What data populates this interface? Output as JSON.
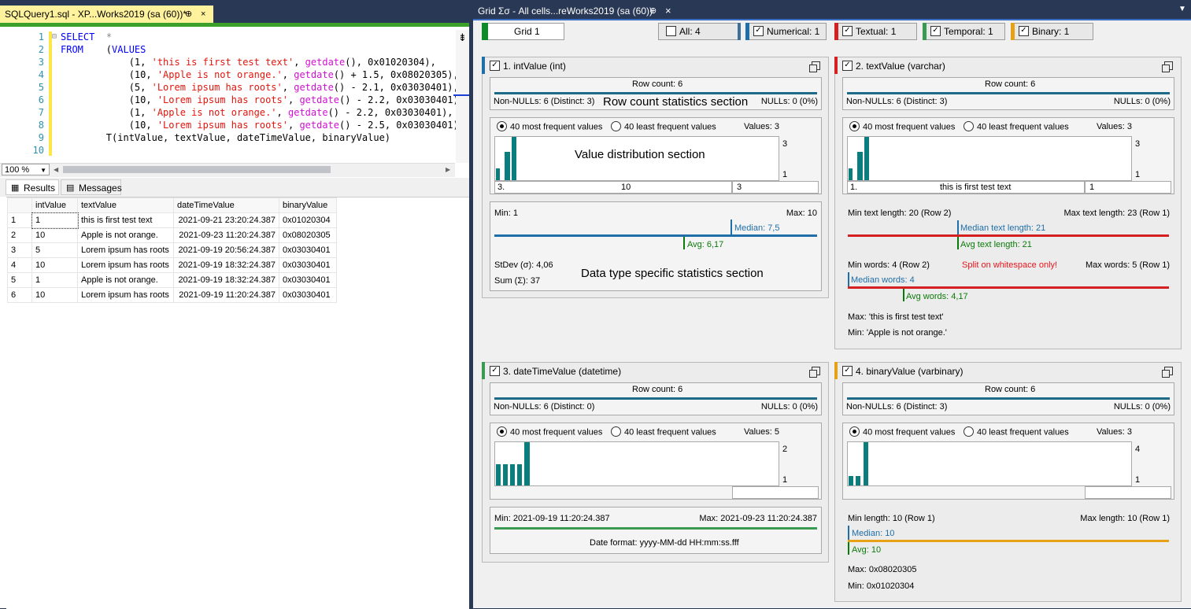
{
  "left_tab": {
    "title": "SQLQuery1.sql - XP...Works2019 (sa (60))*",
    "pin": "⊕",
    "close": "×"
  },
  "editor": {
    "line_numbers": [
      "1",
      "2",
      "3",
      "4",
      "5",
      "6",
      "7",
      "8",
      "9",
      "10"
    ],
    "zoom": "100 %"
  },
  "results": {
    "tabs": [
      "Results",
      "Messages"
    ],
    "columns": [
      "",
      "intValue",
      "textValue",
      "dateTimeValue",
      "binaryValue"
    ],
    "rows": [
      [
        "1",
        "1",
        "this is first test text",
        "2021-09-21 23:20:24.387",
        "0x01020304"
      ],
      [
        "2",
        "10",
        "Apple is not orange.",
        "2021-09-23 11:20:24.387",
        "0x08020305"
      ],
      [
        "3",
        "5",
        "Lorem ipsum has roots",
        "2021-09-19 20:56:24.387",
        "0x03030401"
      ],
      [
        "4",
        "10",
        "Lorem ipsum has roots",
        "2021-09-19 18:32:24.387",
        "0x03030401"
      ],
      [
        "5",
        "1",
        "Apple is not orange.",
        "2021-09-19 18:32:24.387",
        "0x03030401"
      ],
      [
        "6",
        "10",
        "Lorem ipsum has roots",
        "2021-09-19 11:20:24.387",
        "0x03030401"
      ]
    ]
  },
  "right_tab": {
    "title": "Grid Σσ - All cells...reWorks2019 (sa (60))",
    "pin": "⊕",
    "close": "×"
  },
  "toolbar": {
    "grid": "Grid 1",
    "all": "All: 4",
    "numerical": "Numerical: 1",
    "textual": "Textual: 1",
    "temporal": "Temporal: 1",
    "binary": "Binary: 1"
  },
  "colors": {
    "numerical": "#1f6ea8",
    "textual": "#d42020",
    "temporal": "#3a9a52",
    "binary": "#e6a117",
    "grid": "#0f8a2a",
    "teal": "#0a7d7d"
  },
  "panels": {
    "p1": {
      "title": "1. intValue (int)",
      "row_count": "Row count: 6",
      "non_nulls": "Non-NULLs: 6 (Distinct: 3)",
      "nulls": "NULLs: 0 (0%)",
      "overlay_rowcount": "Row count statistics section",
      "most": "40 most frequent values",
      "least": "40 least frequent values",
      "values": "Values: 3",
      "axis_top": "3",
      "axis_bottom": "1",
      "overlay_dist": "Value distribution section",
      "lbl1": "3.",
      "lbl2": "10",
      "lbl3": "3",
      "min": "Min: 1",
      "max": "Max: 10",
      "median": "Median: 7,5",
      "avg": "Avg: 6,17",
      "stdev": "StDev (σ): 4,06",
      "sum": "Sum (Σ): 37",
      "overlay_stats": "Data type specific statistics section"
    },
    "p2": {
      "title": "2. textValue (varchar)",
      "row_count": "Row count: 6",
      "non_nulls": "Non-NULLs: 6 (Distinct: 3)",
      "nulls": "NULLs: 0 (0%)",
      "most": "40 most frequent values",
      "least": "40 least frequent values",
      "values": "Values: 3",
      "axis_top": "3",
      "axis_bottom": "1",
      "lbl1": "1.",
      "lbl2": "this is first test text",
      "lbl3": "1",
      "min_len": "Min text length: 20 (Row 2)",
      "max_len": "Max text length: 23 (Row 1)",
      "median_len": "Median text length: 21",
      "avg_len": "Avg text length: 21",
      "min_words": "Min words: 4 (Row 2)",
      "split": "Split on whitespace only!",
      "max_words": "Max words: 5 (Row 1)",
      "median_words": "Median words: 4",
      "avg_words": "Avg words: 4,17",
      "max_text": "Max: 'this is first test text'",
      "min_text": "Min: 'Apple is not orange.'"
    },
    "p3": {
      "title": "3. dateTimeValue (datetime)",
      "row_count": "Row count: 6",
      "non_nulls": "Non-NULLs: 6 (Distinct: 0)",
      "nulls": "NULLs: 0 (0%)",
      "most": "40 most frequent values",
      "least": "40 least frequent values",
      "values": "Values: 5",
      "axis_top": "2",
      "axis_bottom": "1",
      "min": "Min: 2021-09-19 11:20:24.387",
      "max": "Max: 2021-09-23 11:20:24.387",
      "format": "Date format: yyyy-MM-dd HH:mm:ss.fff"
    },
    "p4": {
      "title": "4. binaryValue (varbinary)",
      "row_count": "Row count: 6",
      "non_nulls": "Non-NULLs: 6 (Distinct: 3)",
      "nulls": "NULLs: 0 (0%)",
      "most": "40 most frequent values",
      "least": "40 least frequent values",
      "values": "Values: 3",
      "axis_top": "4",
      "axis_bottom": "1",
      "min_len": "Min length: 10 (Row 1)",
      "max_len": "Max length: 10 (Row 1)",
      "median": "Median: 10",
      "avg": "Avg: 10",
      "max_val": "Max: 0x08020305",
      "min_val": "Min: 0x01020304"
    }
  }
}
